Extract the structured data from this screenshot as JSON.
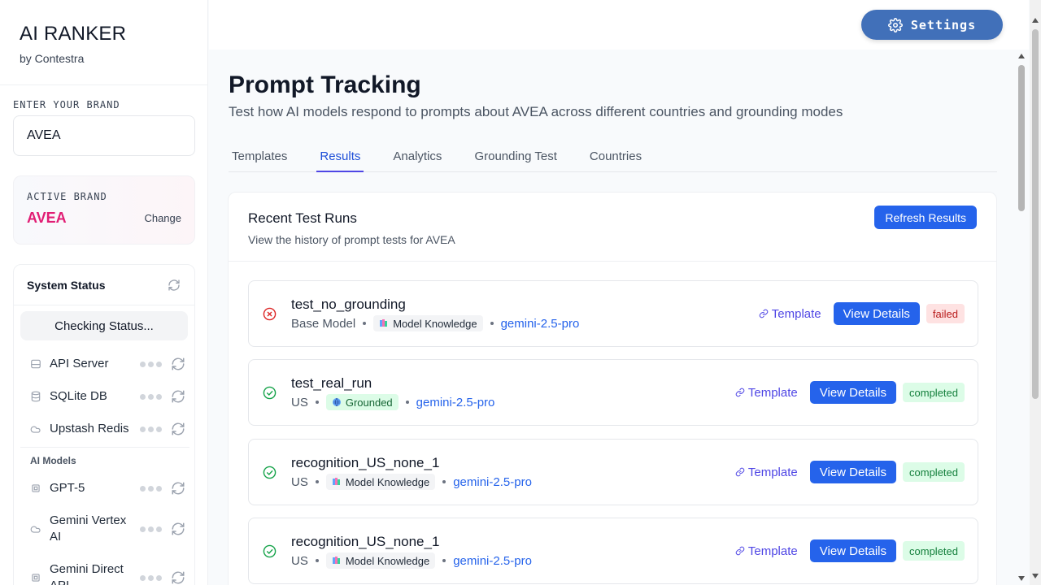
{
  "app": {
    "title": "AI RANKER",
    "subtitle": "by Contestra"
  },
  "brand_input": {
    "label": "ENTER YOUR BRAND",
    "value": "AVEA"
  },
  "active_brand": {
    "label": "ACTIVE BRAND",
    "name": "AVEA",
    "change_label": "Change"
  },
  "system_status": {
    "title": "System Status",
    "checking_label": "Checking Status...",
    "services": [
      {
        "label": "API Server",
        "icon": "server-icon"
      },
      {
        "label": "SQLite DB",
        "icon": "database-icon"
      },
      {
        "label": "Upstash Redis",
        "icon": "cloud-icon"
      }
    ],
    "models_label": "AI Models",
    "models": [
      {
        "label": "GPT-5",
        "icon": "cpu-icon"
      },
      {
        "label": "Gemini Vertex AI",
        "icon": "cloud-icon"
      },
      {
        "label": "Gemini Direct API",
        "icon": "cpu-icon"
      }
    ]
  },
  "header": {
    "settings_label": "Settings"
  },
  "page": {
    "title": "Prompt Tracking",
    "subtitle": "Test how AI models respond to prompts about AVEA across different countries and grounding modes"
  },
  "tabs": [
    {
      "label": "Templates",
      "active": false
    },
    {
      "label": "Results",
      "active": true
    },
    {
      "label": "Analytics",
      "active": false
    },
    {
      "label": "Grounding Test",
      "active": false
    },
    {
      "label": "Countries",
      "active": false
    }
  ],
  "runs": {
    "title": "Recent Test Runs",
    "subtitle": "View the history of prompt tests for AVEA",
    "refresh_label": "Refresh Results",
    "template_label": "Template",
    "view_label": "View Details",
    "items": [
      {
        "name": "test_no_grounding",
        "country": "Base Model",
        "mode": "Model Knowledge",
        "mode_type": "knowledge",
        "model": "gemini-2.5-pro",
        "status": "failed"
      },
      {
        "name": "test_real_run",
        "country": "US",
        "mode": "Grounded",
        "mode_type": "grounded",
        "model": "gemini-2.5-pro",
        "status": "completed"
      },
      {
        "name": "recognition_US_none_1",
        "country": "US",
        "mode": "Model Knowledge",
        "mode_type": "knowledge",
        "model": "gemini-2.5-pro",
        "status": "completed"
      },
      {
        "name": "recognition_US_none_1",
        "country": "US",
        "mode": "Model Knowledge",
        "mode_type": "knowledge",
        "model": "gemini-2.5-pro",
        "status": "completed"
      }
    ]
  },
  "colors": {
    "accent": "#2563eb",
    "brand_pink": "#e11d74",
    "settings_bg": "#4170b9",
    "failed": "#b91c1c",
    "completed": "#15803d"
  }
}
